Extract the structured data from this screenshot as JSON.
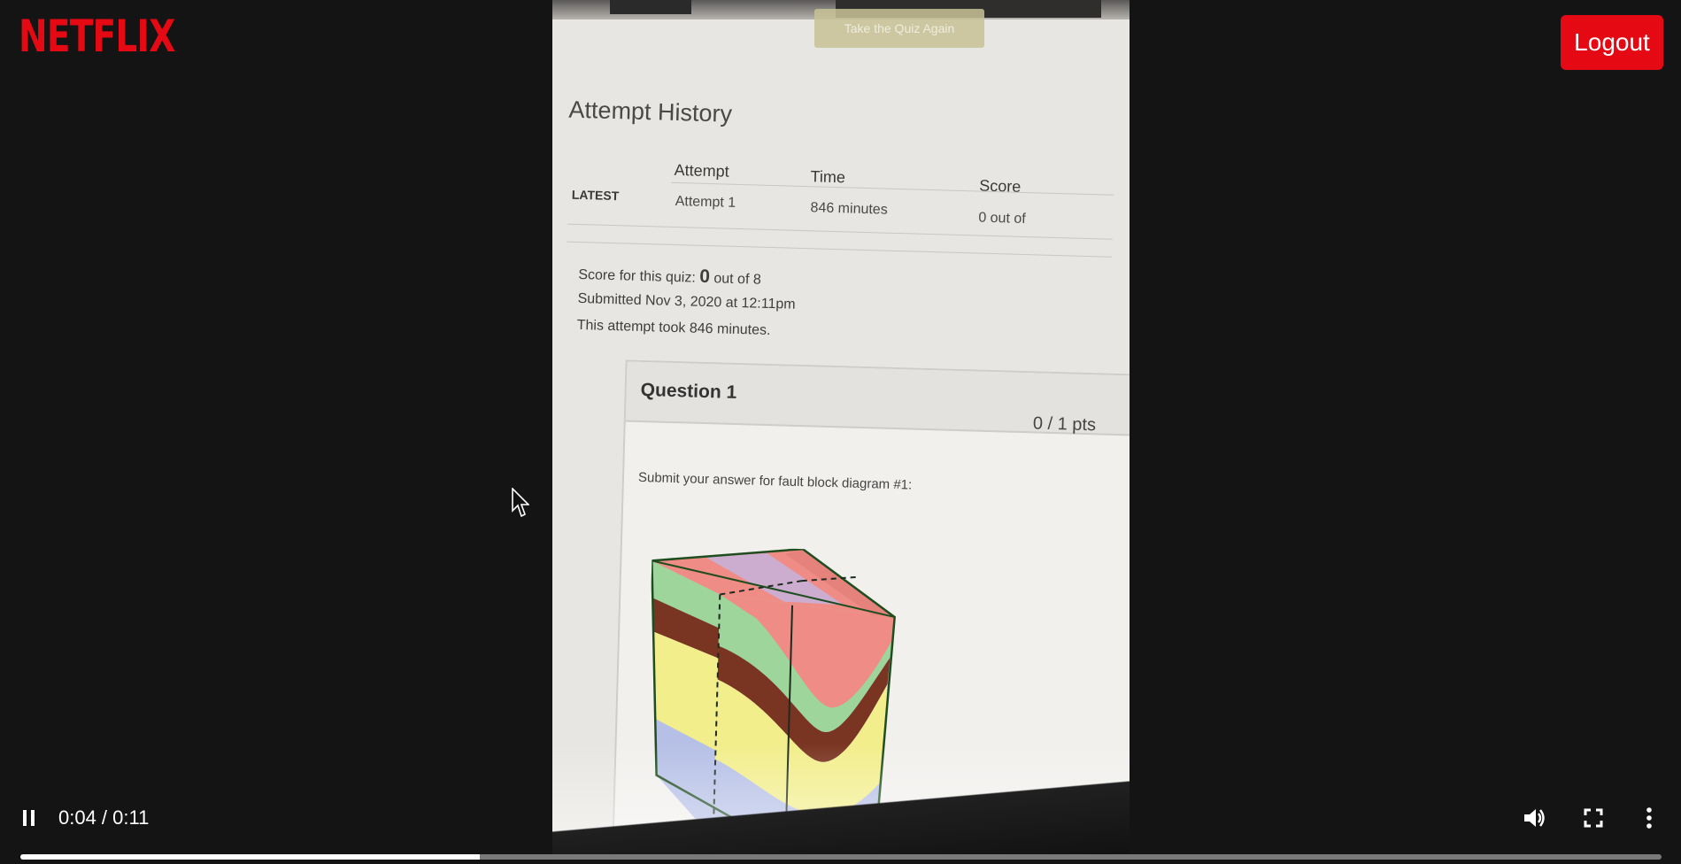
{
  "app": {
    "brand": "NETFLIX",
    "logout_label": "Logout"
  },
  "video_content": {
    "take_again_label": "Take the Quiz Again",
    "attempt_history_title": "Attempt History",
    "table": {
      "headers": [
        "Attempt",
        "Time",
        "Score"
      ],
      "row": {
        "tag": "LATEST",
        "attempt": "Attempt 1",
        "time": "846 minutes",
        "score": "0 out of"
      }
    },
    "score_prefix": "Score for this quiz:",
    "score_value": "0",
    "score_suffix": "out of 8",
    "submitted": "Submitted Nov 3, 2020 at 12:11pm",
    "attempt_took": "This attempt took 846 minutes.",
    "question": {
      "title": "Question 1",
      "points": "0 / 1 pts",
      "prompt": "Submit your answer for fault block diagram #1:"
    }
  },
  "player": {
    "current_time": "0:04",
    "duration": "0:11",
    "time_display": "0:04 / 0:11",
    "progress_percent": 28,
    "icons": {
      "play_pause": "pause-icon",
      "volume": "volume-icon",
      "fullscreen": "fullscreen-icon",
      "more": "more-vert-icon"
    }
  },
  "colors": {
    "brand_red": "#e50914",
    "background": "#141414"
  }
}
